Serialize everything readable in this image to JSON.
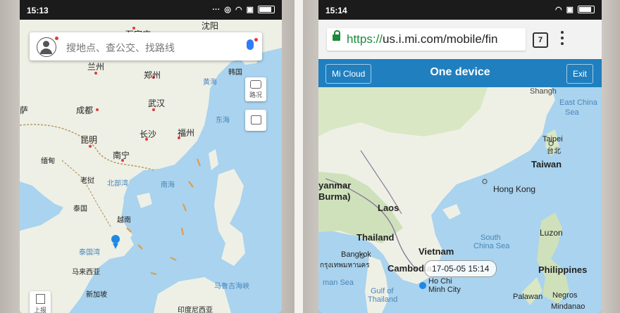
{
  "left_phone": {
    "status": {
      "time": "15:13"
    },
    "search": {
      "placeholder": "搜地点、查公交、找路线"
    },
    "buttons": {
      "traffic_label": "路况",
      "report_label": "上报"
    },
    "map_labels": {
      "top_city": "沈阳",
      "lanzhou": "兰州",
      "zhengzhou": "郑州",
      "korea": "韩国",
      "chengdu": "成都",
      "wuhan": "武汉",
      "tibet_partial": "萨",
      "kunming": "昆明",
      "changsha": "长沙",
      "fuzhou": "福州",
      "myanmar": "缅甸",
      "laos": "老挝",
      "nanning": "南宁",
      "beibu_gulf": "北部湾",
      "south_sea": "南海",
      "thailand": "泰国",
      "vietnam": "越南",
      "gulf_thailand": "泰国湾",
      "malaysia": "马来西亚",
      "singapore": "新加坡",
      "indonesia": "印度尼西亚",
      "sulawesi_sea": "马鲁古海峡",
      "east_sea": "东海",
      "yellow_sea": "黄海",
      "shijiazhuang_partial": "石家庄"
    }
  },
  "right_phone": {
    "status": {
      "time": "15:14"
    },
    "browser": {
      "url_scheme": "https://",
      "url_rest": "us.i.mi.com/mobile/fin",
      "tab_count": "7"
    },
    "header": {
      "left_button": "Mi Cloud",
      "title": "One device",
      "right_button": "Exit"
    },
    "map_labels": {
      "east_china": "East China",
      "east_china_2": "Sea",
      "taipei": "Taipei",
      "taipei_zh": "台北",
      "taiwan": "Taiwan",
      "hong_kong": "Hong Kong",
      "myanmar": "yanmar",
      "burma": "Burma)",
      "laos": "Laos",
      "thailand": "Thailand",
      "vietnam": "Vietnam",
      "south_china_sea": "South",
      "south_china_sea_2": "China Sea",
      "luzon": "Luzon",
      "bangkok": "Bangkok",
      "bangkok_th": "กรุงเทพมหานคร",
      "cambodia": "Cambodia",
      "philippines": "Philippines",
      "gulf_thailand": "Gulf of",
      "gulf_thailand_2": "Thailand",
      "ho_chi_minh": "Ho Chi",
      "ho_chi_minh_2": "Minh City",
      "palawan": "Palawan",
      "negros": "Negros",
      "mindanao": "Mindanao",
      "andaman": "man Sea",
      "shanghai_partial": "Shangh"
    },
    "device_timestamp": "17-05-05 15:14"
  },
  "colors": {
    "water": "#a9d3ee",
    "land": "#eef0e6",
    "mi_blue": "#1f7fbf",
    "location_dot": "#1e88e5"
  }
}
